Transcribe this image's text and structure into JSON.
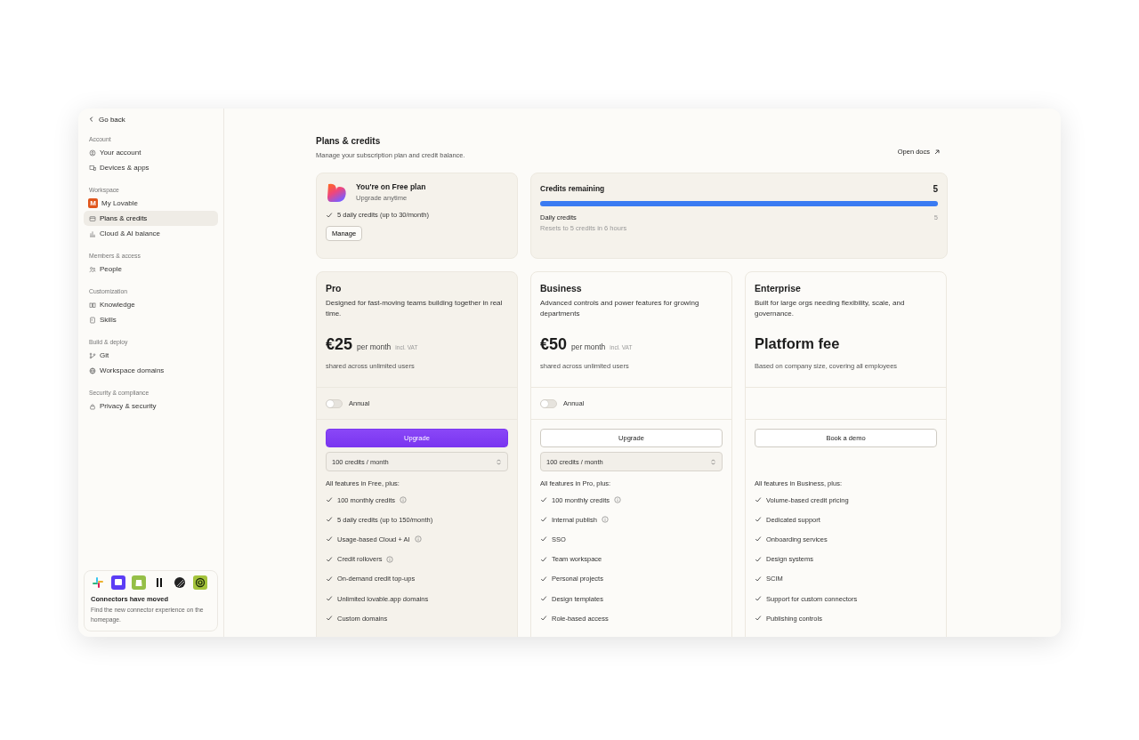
{
  "sidebar": {
    "back": "Go back",
    "sections": [
      {
        "title": "Account",
        "items": [
          {
            "label": "Your account",
            "selected": false
          },
          {
            "label": "Devices & apps",
            "selected": false
          }
        ]
      },
      {
        "title": "Workspace",
        "items": [
          {
            "label": "My Lovable",
            "selected": false,
            "badge": "M"
          },
          {
            "label": "Plans & credits",
            "selected": true
          },
          {
            "label": "Cloud & AI balance",
            "selected": false
          }
        ]
      },
      {
        "title": "Members & access",
        "items": [
          {
            "label": "People",
            "selected": false
          }
        ]
      },
      {
        "title": "Customization",
        "items": [
          {
            "label": "Knowledge",
            "selected": false
          },
          {
            "label": "Skills",
            "selected": false
          }
        ]
      },
      {
        "title": "Build & deploy",
        "items": [
          {
            "label": "Git",
            "selected": false
          },
          {
            "label": "Workspace domains",
            "selected": false
          }
        ]
      },
      {
        "title": "Security & compliance",
        "items": [
          {
            "label": "Privacy & security",
            "selected": false
          }
        ]
      }
    ],
    "notice": {
      "title": "Connectors have moved",
      "text": "Find the new connector experience on the homepage."
    }
  },
  "header": {
    "title": "Plans & credits",
    "subtitle": "Manage your subscription plan and credit balance.",
    "docs_link": "Open docs"
  },
  "current_plan": {
    "title": "You're on Free plan",
    "subtitle": "Upgrade anytime",
    "feature": "5 daily credits (up to 30/month)",
    "button": "Manage"
  },
  "credits": {
    "title": "Credits remaining",
    "total": "5",
    "level": 1.0,
    "daily_label": "Daily credits",
    "daily_note": "Resets to 5 credits in 6 hours",
    "daily_value": "5"
  },
  "plans": [
    {
      "name": "Pro",
      "highlighted": true,
      "description": "Designed for fast-moving teams building together in real time.",
      "price": "€25",
      "period": "per month",
      "tax": "incl. VAT",
      "price_note": "shared across unlimited users",
      "annual": {
        "label": "Annual",
        "on": false
      },
      "button": {
        "label": "Upgrade",
        "primary": true
      },
      "select": "100 credits / month",
      "features_title": "All features in Free, plus:",
      "features": [
        {
          "text": "100 monthly credits",
          "info": true
        },
        {
          "text": "5 daily credits (up to 150/month)",
          "info": false
        },
        {
          "text": "Usage-based Cloud + AI",
          "info": true
        },
        {
          "text": "Credit rollovers",
          "info": true
        },
        {
          "text": "On-demand credit top-ups",
          "info": false
        },
        {
          "text": "Unlimited lovable.app domains",
          "info": false
        },
        {
          "text": "Custom domains",
          "info": false
        }
      ]
    },
    {
      "name": "Business",
      "highlighted": false,
      "description": "Advanced controls and power features for growing departments",
      "price": "€50",
      "period": "per month",
      "tax": "incl. VAT",
      "price_note": "shared across unlimited users",
      "annual": {
        "label": "Annual",
        "on": false
      },
      "button": {
        "label": "Upgrade",
        "primary": false
      },
      "select": "100 credits / month",
      "features_title": "All features in Pro, plus:",
      "features": [
        {
          "text": "100 monthly credits",
          "info": true
        },
        {
          "text": "Internal publish",
          "info": true
        },
        {
          "text": "SSO",
          "info": false
        },
        {
          "text": "Team workspace",
          "info": false
        },
        {
          "text": "Personal projects",
          "info": false
        },
        {
          "text": "Design templates",
          "info": false
        },
        {
          "text": "Role-based access",
          "info": false
        }
      ]
    },
    {
      "name": "Enterprise",
      "highlighted": false,
      "description": "Built for large orgs needing flexibility, scale, and governance.",
      "price": "Platform fee",
      "price_note": "Based on company size, covering all employees",
      "button": {
        "label": "Book a demo",
        "primary": false
      },
      "features_title": "All features in Business, plus:",
      "features": [
        {
          "text": "Volume-based credit pricing",
          "info": false
        },
        {
          "text": "Dedicated support",
          "info": false
        },
        {
          "text": "Onboarding services",
          "info": false
        },
        {
          "text": "Design systems",
          "info": false
        },
        {
          "text": "SCIM",
          "info": false
        },
        {
          "text": "Support for custom connectors",
          "info": false
        },
        {
          "text": "Publishing controls",
          "info": false
        }
      ]
    }
  ]
}
